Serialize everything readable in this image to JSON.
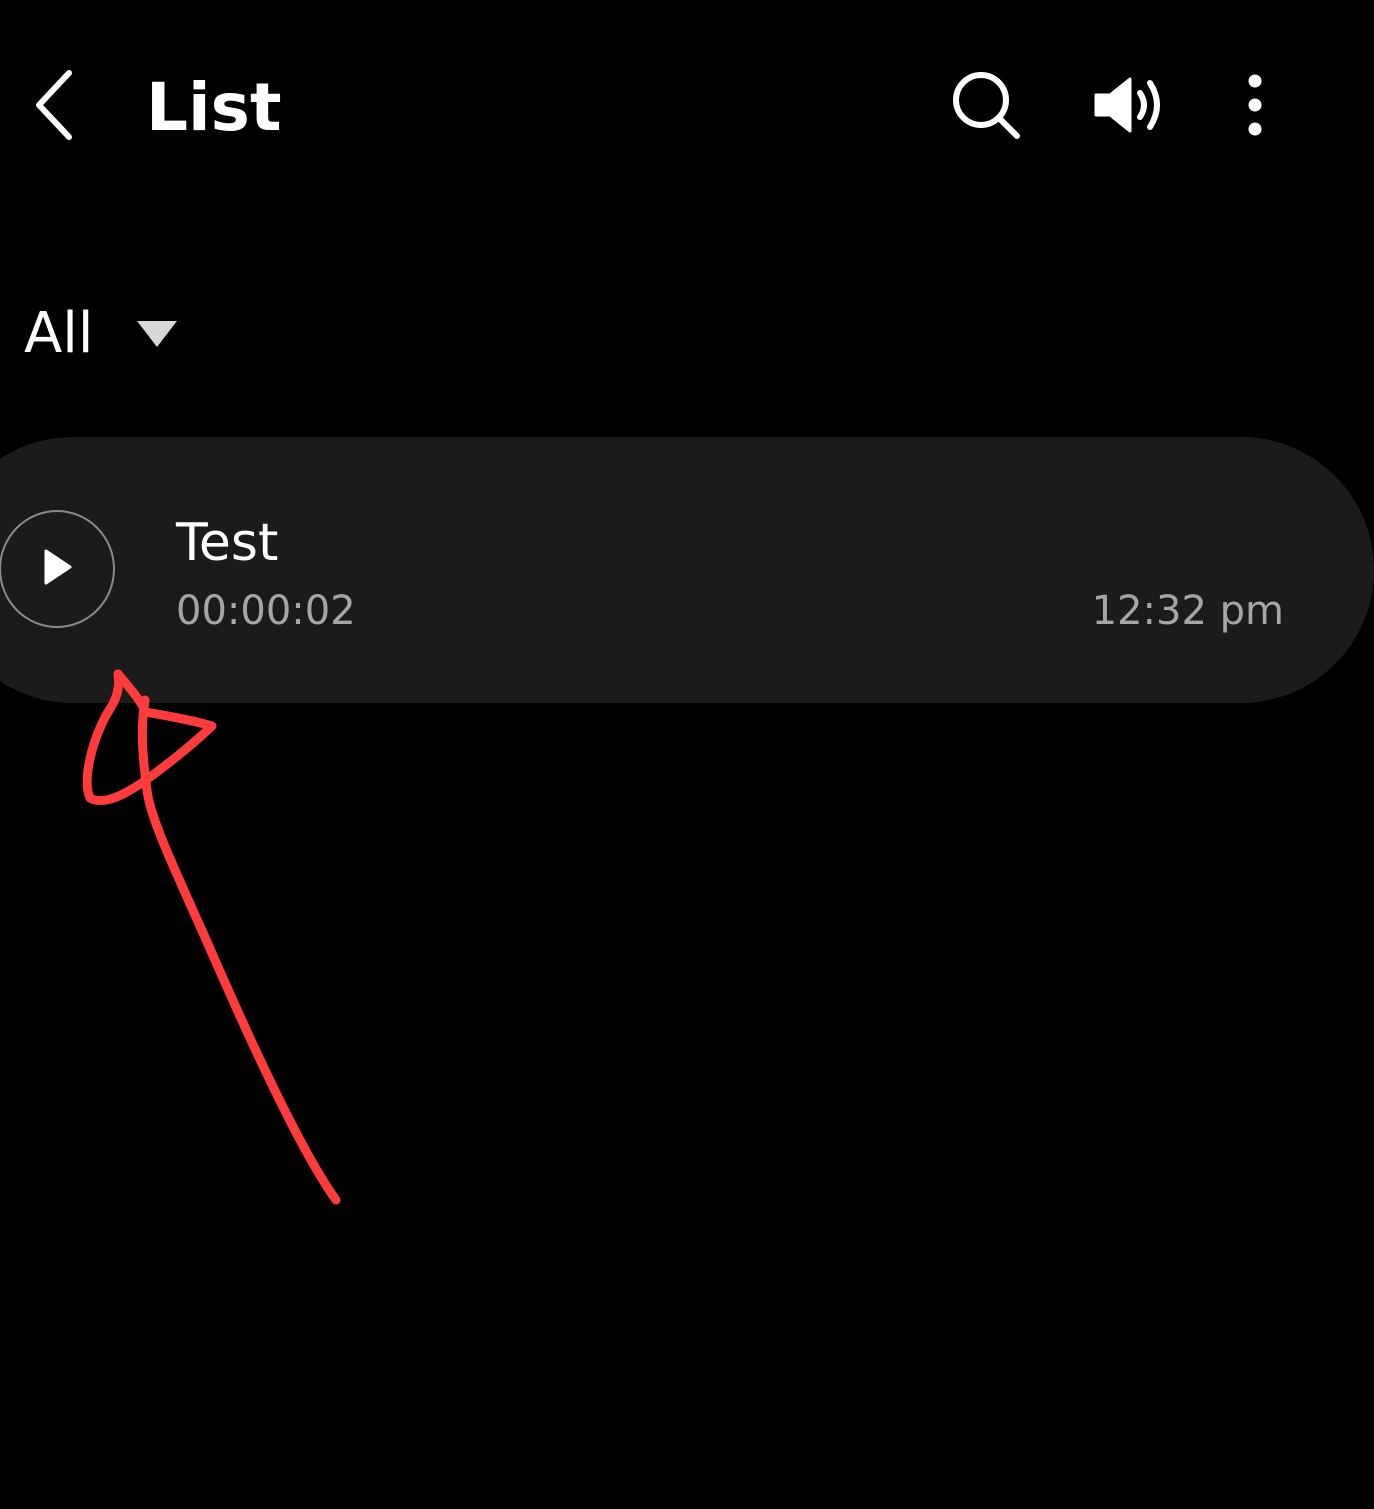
{
  "app_bar": {
    "title": "List",
    "back_icon": "chevron-left-icon",
    "actions": [
      {
        "name": "search",
        "icon": "search-icon"
      },
      {
        "name": "speaker",
        "icon": "speaker-icon"
      },
      {
        "name": "more",
        "icon": "more-vertical-icon"
      }
    ]
  },
  "filter": {
    "selected": "All",
    "icon": "triangle-down-icon"
  },
  "recordings": [
    {
      "title": "Test",
      "duration": "00:00:02",
      "time": "12:32 pm",
      "icon": "play-icon"
    }
  ],
  "colors": {
    "background": "#000000",
    "card": "#1b1b1b",
    "primary_text": "#ffffff",
    "secondary_text": "#a6a6a6",
    "annotation": "#ff3b3b"
  }
}
